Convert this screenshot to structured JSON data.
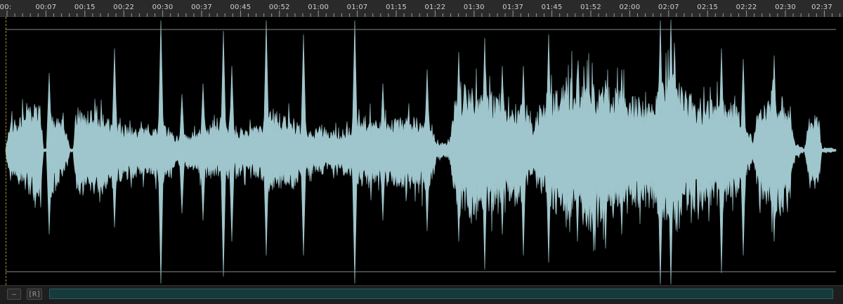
{
  "ruler": {
    "ticks": [
      "00:",
      "00:07",
      "00:15",
      "00:22",
      "00:30",
      "00:37",
      "00:45",
      "00:52",
      "01:00",
      "01:07",
      "01:15",
      "01:22",
      "01:30",
      "01:37",
      "01:45",
      "01:52",
      "02:00",
      "02:07",
      "02:15",
      "02:22",
      "02:30",
      "02:37"
    ]
  },
  "waveform": {
    "color": "#9fc6cc",
    "guide_color": "#8a8a8a",
    "background": "#000000"
  },
  "bottom_bar": {
    "zoom_out_label": "–",
    "reset_label": "[R]",
    "scroll_color": "#173a3c"
  },
  "colors": {
    "ruler_bg": "#2a2a2a",
    "ruler_text": "#cfcfcf",
    "playhead": "#d7b44a"
  }
}
